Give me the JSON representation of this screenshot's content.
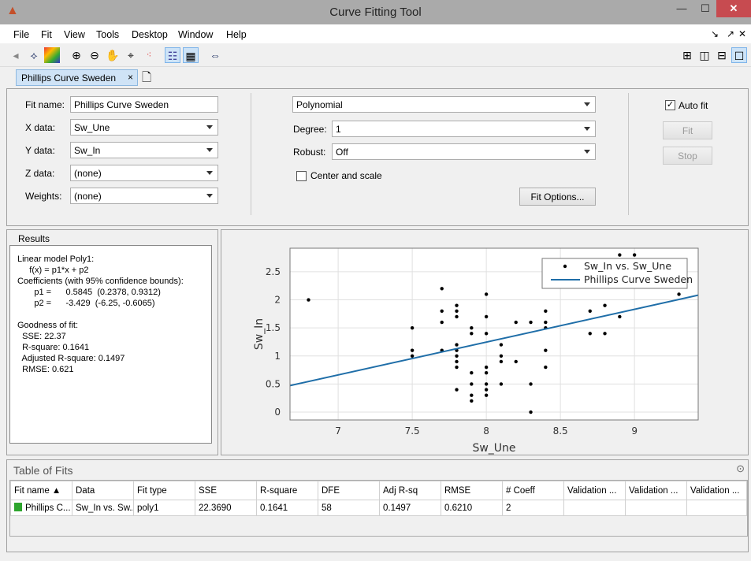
{
  "window": {
    "title": "Curve Fitting Tool",
    "minimize": "—",
    "maximize": "☐",
    "close": "✕"
  },
  "menu": [
    "File",
    "Fit",
    "View",
    "Tools",
    "Desktop",
    "Window",
    "Help"
  ],
  "tab": {
    "label": "Phillips Curve Sweden",
    "close": "×"
  },
  "fit_panel": {
    "fit_name_label": "Fit name:",
    "fit_name": "Phillips Curve Sweden",
    "x_label": "X data:",
    "x_value": "Sw_Une",
    "y_label": "Y data:",
    "y_value": "Sw_In",
    "z_label": "Z data:",
    "z_value": "(none)",
    "w_label": "Weights:",
    "w_value": "(none)",
    "fit_type": "Polynomial",
    "degree_label": "Degree:",
    "degree": "1",
    "robust_label": "Robust:",
    "robust": "Off",
    "center_scale": "Center and scale",
    "center_scale_checked": false,
    "fit_options": "Fit Options...",
    "auto_fit": "Auto fit",
    "auto_fit_checked": true,
    "fit_button": "Fit",
    "stop_button": "Stop"
  },
  "results": {
    "title": "Results",
    "text": "Linear model Poly1:\n     f(x) = p1*x + p2\nCoefficients (with 95% confidence bounds):\n       p1 =      0.5845  (0.2378, 0.9312)\n       p2 =      -3.429  (-6.25, -0.6065)\n\nGoodness of fit:\n  SSE: 22.37\n  R-square: 0.1641\n  Adjusted R-square: 0.1497\n  RMSE: 0.621"
  },
  "chart_data": {
    "type": "scatter",
    "xlabel": "Sw_Une",
    "ylabel": "Sw_In",
    "xlim": [
      6.675,
      9.43
    ],
    "ylim": [
      -0.14,
      2.92
    ],
    "xticks": [
      7,
      7.5,
      8,
      8.5,
      9
    ],
    "yticks": [
      0,
      0.5,
      1,
      1.5,
      2,
      2.5
    ],
    "grid": true,
    "legend_position": "top-right",
    "points_color": "#000000",
    "line_color": "#1f6ea8",
    "series": [
      {
        "name": "Sw_In vs. Sw_Une",
        "kind": "points",
        "x": [
          6.8,
          7.5,
          7.5,
          7.5,
          7.7,
          7.7,
          7.7,
          7.7,
          7.8,
          7.8,
          7.8,
          7.8,
          7.8,
          7.8,
          7.8,
          7.8,
          7.8,
          7.9,
          7.9,
          7.9,
          7.9,
          7.9,
          7.9,
          8.0,
          8.0,
          8.0,
          8.0,
          8.0,
          8.0,
          8.0,
          8.0,
          8.1,
          8.1,
          8.1,
          8.1,
          8.2,
          8.2,
          8.3,
          8.3,
          8.3,
          8.4,
          8.4,
          8.4,
          8.4,
          8.4,
          8.7,
          8.7,
          8.8,
          8.8,
          8.9,
          8.9,
          9.0,
          9.3
        ],
        "y": [
          2.0,
          1.5,
          1.1,
          1.0,
          2.2,
          1.8,
          1.6,
          1.1,
          1.9,
          1.8,
          1.7,
          1.2,
          1.1,
          1.0,
          0.9,
          0.8,
          0.4,
          1.5,
          1.4,
          0.7,
          0.5,
          0.3,
          0.2,
          2.1,
          1.7,
          1.4,
          0.8,
          0.7,
          0.5,
          0.4,
          0.3,
          1.2,
          1.0,
          0.9,
          0.5,
          1.6,
          0.9,
          1.6,
          0.5,
          0.0,
          1.8,
          1.6,
          1.5,
          1.1,
          0.8,
          1.8,
          1.4,
          1.9,
          1.4,
          2.8,
          1.7,
          2.8,
          2.1
        ]
      },
      {
        "name": "Phillips Curve Sweden",
        "kind": "line",
        "p1": 0.5845,
        "p2": -3.429
      }
    ]
  },
  "table": {
    "title": "Table of Fits",
    "columns": [
      "Fit name ▲",
      "Data",
      "Fit type",
      "SSE",
      "R-square",
      "DFE",
      "Adj R-sq",
      "RMSE",
      "# Coeff",
      "Validation ...",
      "Validation ...",
      "Validation ..."
    ],
    "rows": [
      [
        "Phillips C...",
        "Sw_In vs. Sw...",
        "poly1",
        "22.3690",
        "0.1641",
        "58",
        "0.1497",
        "0.6210",
        "2",
        "",
        "",
        ""
      ]
    ],
    "row_color": "#2ea52e"
  }
}
